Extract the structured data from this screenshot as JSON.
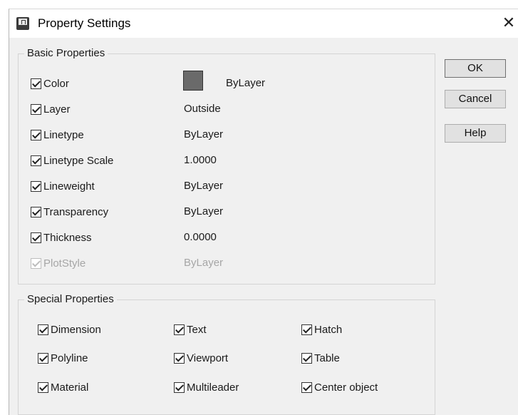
{
  "window": {
    "title": "Property Settings",
    "close_glyph": "✕"
  },
  "basic": {
    "label": "Basic Properties",
    "color": {
      "label": "Color",
      "value": "ByLayer",
      "swatch_color": "#6a6a6a"
    },
    "layer": {
      "label": "Layer",
      "value": "Outside"
    },
    "linetype": {
      "label": "Linetype",
      "value": "ByLayer"
    },
    "linetype_scale": {
      "label": "Linetype Scale",
      "value": "1.0000"
    },
    "lineweight": {
      "label": "Lineweight",
      "value": "ByLayer"
    },
    "transparency": {
      "label": "Transparency",
      "value": "ByLayer"
    },
    "thickness": {
      "label": "Thickness",
      "value": "0.0000"
    },
    "plotstyle": {
      "label": "PlotStyle",
      "value": "ByLayer"
    }
  },
  "special": {
    "label": "Special Properties",
    "items": [
      "Dimension",
      "Text",
      "Hatch",
      "Polyline",
      "Viewport",
      "Table",
      "Material",
      "Multileader",
      "Center object"
    ]
  },
  "buttons": {
    "ok": "OK",
    "cancel": "Cancel",
    "help": "Help"
  }
}
